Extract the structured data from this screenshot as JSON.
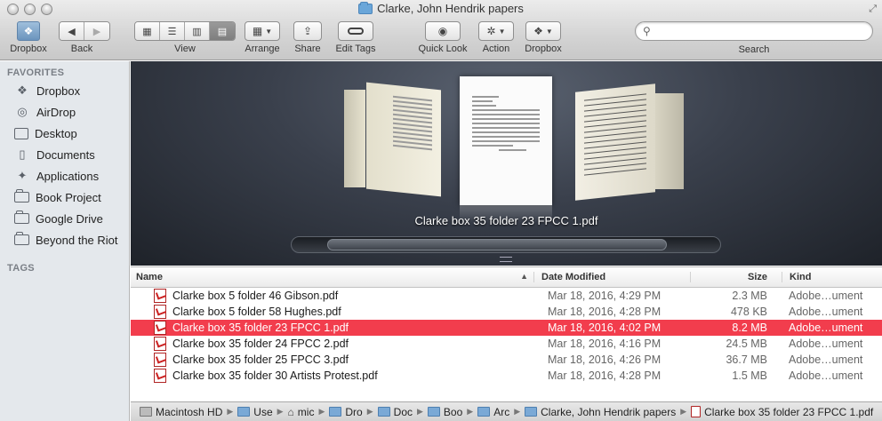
{
  "window": {
    "title": "Clarke, John Hendrik papers"
  },
  "toolbar": {
    "dropbox_label": "Dropbox",
    "back_label": "Back",
    "view_label": "View",
    "arrange_label": "Arrange",
    "share_label": "Share",
    "edit_tags_label": "Edit Tags",
    "quick_look_label": "Quick Look",
    "action_label": "Action",
    "dropbox_menu_label": "Dropbox",
    "search_label": "Search",
    "search_placeholder": ""
  },
  "sidebar": {
    "favorites_heading": "FAVORITES",
    "items": [
      {
        "label": "Dropbox",
        "icon": "dropbox-icon"
      },
      {
        "label": "AirDrop",
        "icon": "airdrop-icon"
      },
      {
        "label": "Desktop",
        "icon": "desktop-icon"
      },
      {
        "label": "Documents",
        "icon": "documents-icon"
      },
      {
        "label": "Applications",
        "icon": "applications-icon"
      },
      {
        "label": "Book Project",
        "icon": "folder-icon"
      },
      {
        "label": "Google Drive",
        "icon": "folder-icon"
      },
      {
        "label": "Beyond the Riot",
        "icon": "folder-icon"
      }
    ],
    "tags_heading": "TAGS"
  },
  "coverflow": {
    "selected_title": "Clarke box 35 folder 23 FPCC 1.pdf"
  },
  "list": {
    "columns": {
      "name": "Name",
      "date": "Date Modified",
      "size": "Size",
      "kind": "Kind"
    },
    "rows": [
      {
        "name": "Clarke box 5 folder 46 Gibson.pdf",
        "date": "Mar 18, 2016, 4:29 PM",
        "size": "2.3 MB",
        "kind": "Adobe…ument"
      },
      {
        "name": "Clarke box 5 folder 58 Hughes.pdf",
        "date": "Mar 18, 2016, 4:28 PM",
        "size": "478 KB",
        "kind": "Adobe…ument"
      },
      {
        "name": "Clarke box 35 folder 23 FPCC 1.pdf",
        "date": "Mar 18, 2016, 4:02 PM",
        "size": "8.2 MB",
        "kind": "Adobe…ument"
      },
      {
        "name": "Clarke box 35 folder 24 FPCC 2.pdf",
        "date": "Mar 18, 2016, 4:16 PM",
        "size": "24.5 MB",
        "kind": "Adobe…ument"
      },
      {
        "name": "Clarke box 35 folder 25 FPCC 3.pdf",
        "date": "Mar 18, 2016, 4:26 PM",
        "size": "36.7 MB",
        "kind": "Adobe…ument"
      },
      {
        "name": "Clarke box 35 folder 30 Artists Protest.pdf",
        "date": "Mar 18, 2016, 4:28 PM",
        "size": "1.5 MB",
        "kind": "Adobe…ument"
      }
    ]
  },
  "pathbar": {
    "items": [
      "Macintosh HD",
      "Use",
      "mic",
      "Dro",
      "Doc",
      "Boo",
      "Arc",
      "Clarke, John Hendrik papers",
      "Clarke box 35 folder 23 FPCC 1.pdf"
    ]
  },
  "colors": {
    "selection": "#f23d4d",
    "coverflow_bg": "#2f343d"
  }
}
